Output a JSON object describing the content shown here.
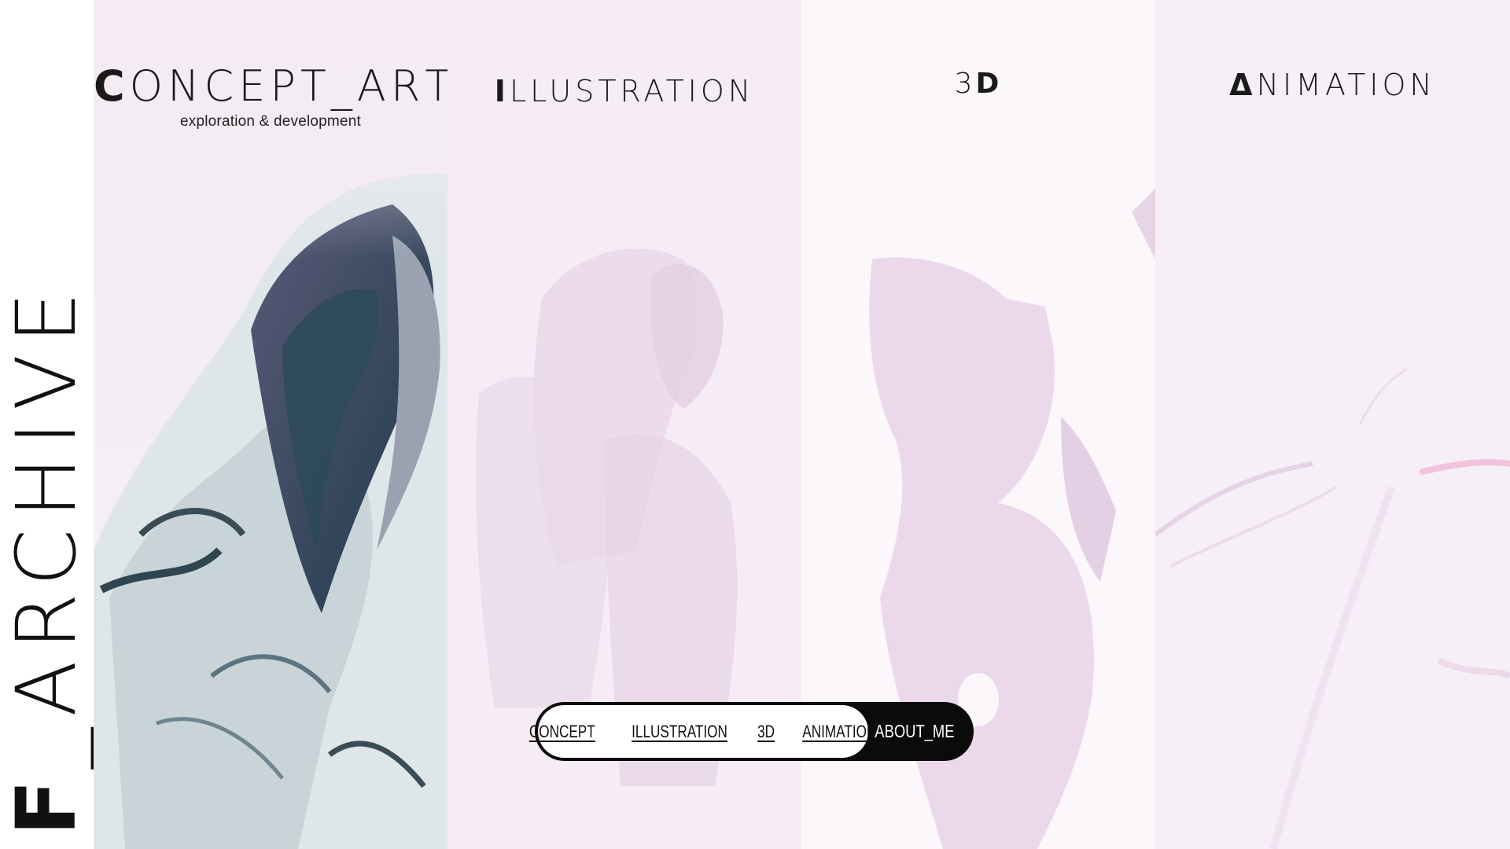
{
  "logo": {
    "first": "F",
    "rest": "_ARCHIVE"
  },
  "panels": [
    {
      "title_first": "C",
      "title_rest": "ONCEPT_ARТ",
      "subtitle": "exploration & development"
    },
    {
      "title_first": "I",
      "title_rest": "LLUSTRATION",
      "subtitle": ""
    },
    {
      "title_first": "3",
      "title_rest": "D",
      "subtitle": ""
    },
    {
      "title_first": "Δ",
      "title_rest": "NIMATION",
      "subtitle": ""
    }
  ],
  "nav": {
    "links": [
      "CONCEPT",
      "ILLUSTRATION",
      "3D",
      "ANIMATION"
    ],
    "about": "ABOUT_ME"
  },
  "colors": {
    "panel_tint": "#f5ecf5",
    "ink": "#111111",
    "pill": "#0b0b0b"
  }
}
